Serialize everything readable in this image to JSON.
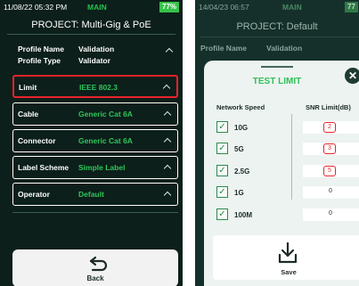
{
  "left": {
    "status": {
      "time": "11/08/22 05:32 PM",
      "mode": "MAIN",
      "battery": "77%"
    },
    "title": "PROJECT: Multi-Gig & PoE",
    "profile": {
      "name_label": "Profile Name",
      "name_value": "Validation",
      "type_label": "Profile Type",
      "type_value": "Validator"
    },
    "rows": [
      {
        "label": "Limit",
        "value": "IEEE 802.3"
      },
      {
        "label": "Cable",
        "value": "Generic Cat 6A"
      },
      {
        "label": "Connector",
        "value": "Generic Cat 6A"
      },
      {
        "label": "Label Scheme",
        "value": "Simple Label"
      },
      {
        "label": "Operator",
        "value": "Default"
      }
    ],
    "back_label": "Back"
  },
  "right": {
    "status": {
      "time": "14/04/23 06:57",
      "mode": "MAIN",
      "battery": "77"
    },
    "title": "PROJECT: Default",
    "profile_name_label": "Profile Name",
    "profile_name_value": "Validation",
    "dialog": {
      "title": "TEST LIMIT",
      "col_speed": "Network Speed",
      "col_snr": "SNR Limit(dB)",
      "rows": [
        {
          "speed": "10G",
          "snr": "2",
          "checked": true
        },
        {
          "speed": "5G",
          "snr": "3",
          "checked": true
        },
        {
          "speed": "2.5G",
          "snr": "5",
          "checked": true
        },
        {
          "speed": "1G",
          "snr": "0",
          "checked": true
        },
        {
          "speed": "100M",
          "snr": "0",
          "checked": true
        }
      ],
      "save_label": "Save"
    }
  },
  "colors": {
    "accent_green": "#2fc65a",
    "highlight_red": "#e8242c",
    "dark_bg": "#0c1f1a"
  },
  "icons": {
    "back": "back-arrow-icon",
    "save": "save-download-icon",
    "close": "close-icon",
    "chevron": "chevron-up-icon",
    "check": "checkbox-icon"
  }
}
